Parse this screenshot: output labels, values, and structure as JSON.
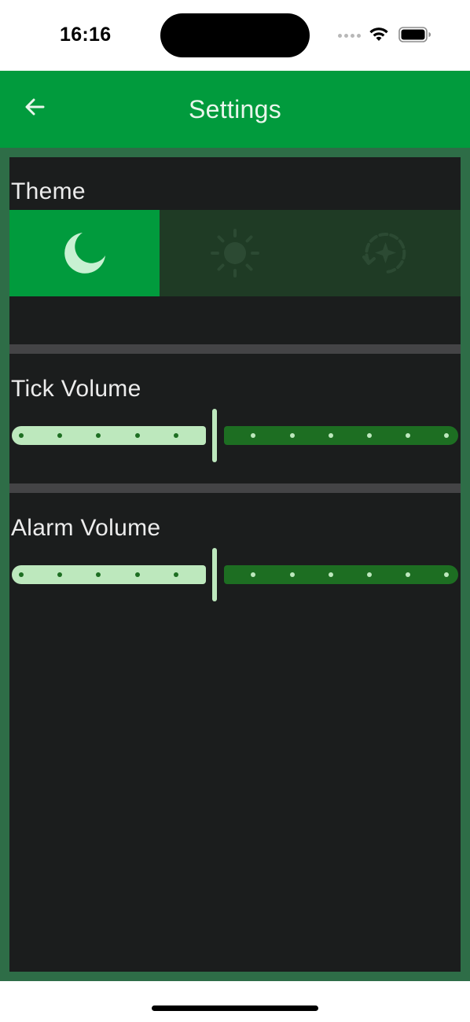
{
  "status_bar": {
    "time": "16:16"
  },
  "app_bar": {
    "title": "Settings",
    "back_icon": "arrow-left-icon",
    "background": "#019b3d"
  },
  "theme": {
    "label": "Theme",
    "options": [
      {
        "icon": "moon-icon",
        "selected": true
      },
      {
        "icon": "sun-icon",
        "selected": false
      },
      {
        "icon": "auto-theme-icon",
        "selected": false
      }
    ]
  },
  "tick_volume": {
    "label": "Tick Volume",
    "value_fraction": 0.45
  },
  "alarm_volume": {
    "label": "Alarm Volume",
    "value_fraction": 0.45
  },
  "colors": {
    "accent": "#019b3d",
    "panel": "#1b1d1d",
    "frame": "#2e6d47",
    "slider_active": "#bde8bd",
    "slider_inactive": "#1d6e22"
  }
}
